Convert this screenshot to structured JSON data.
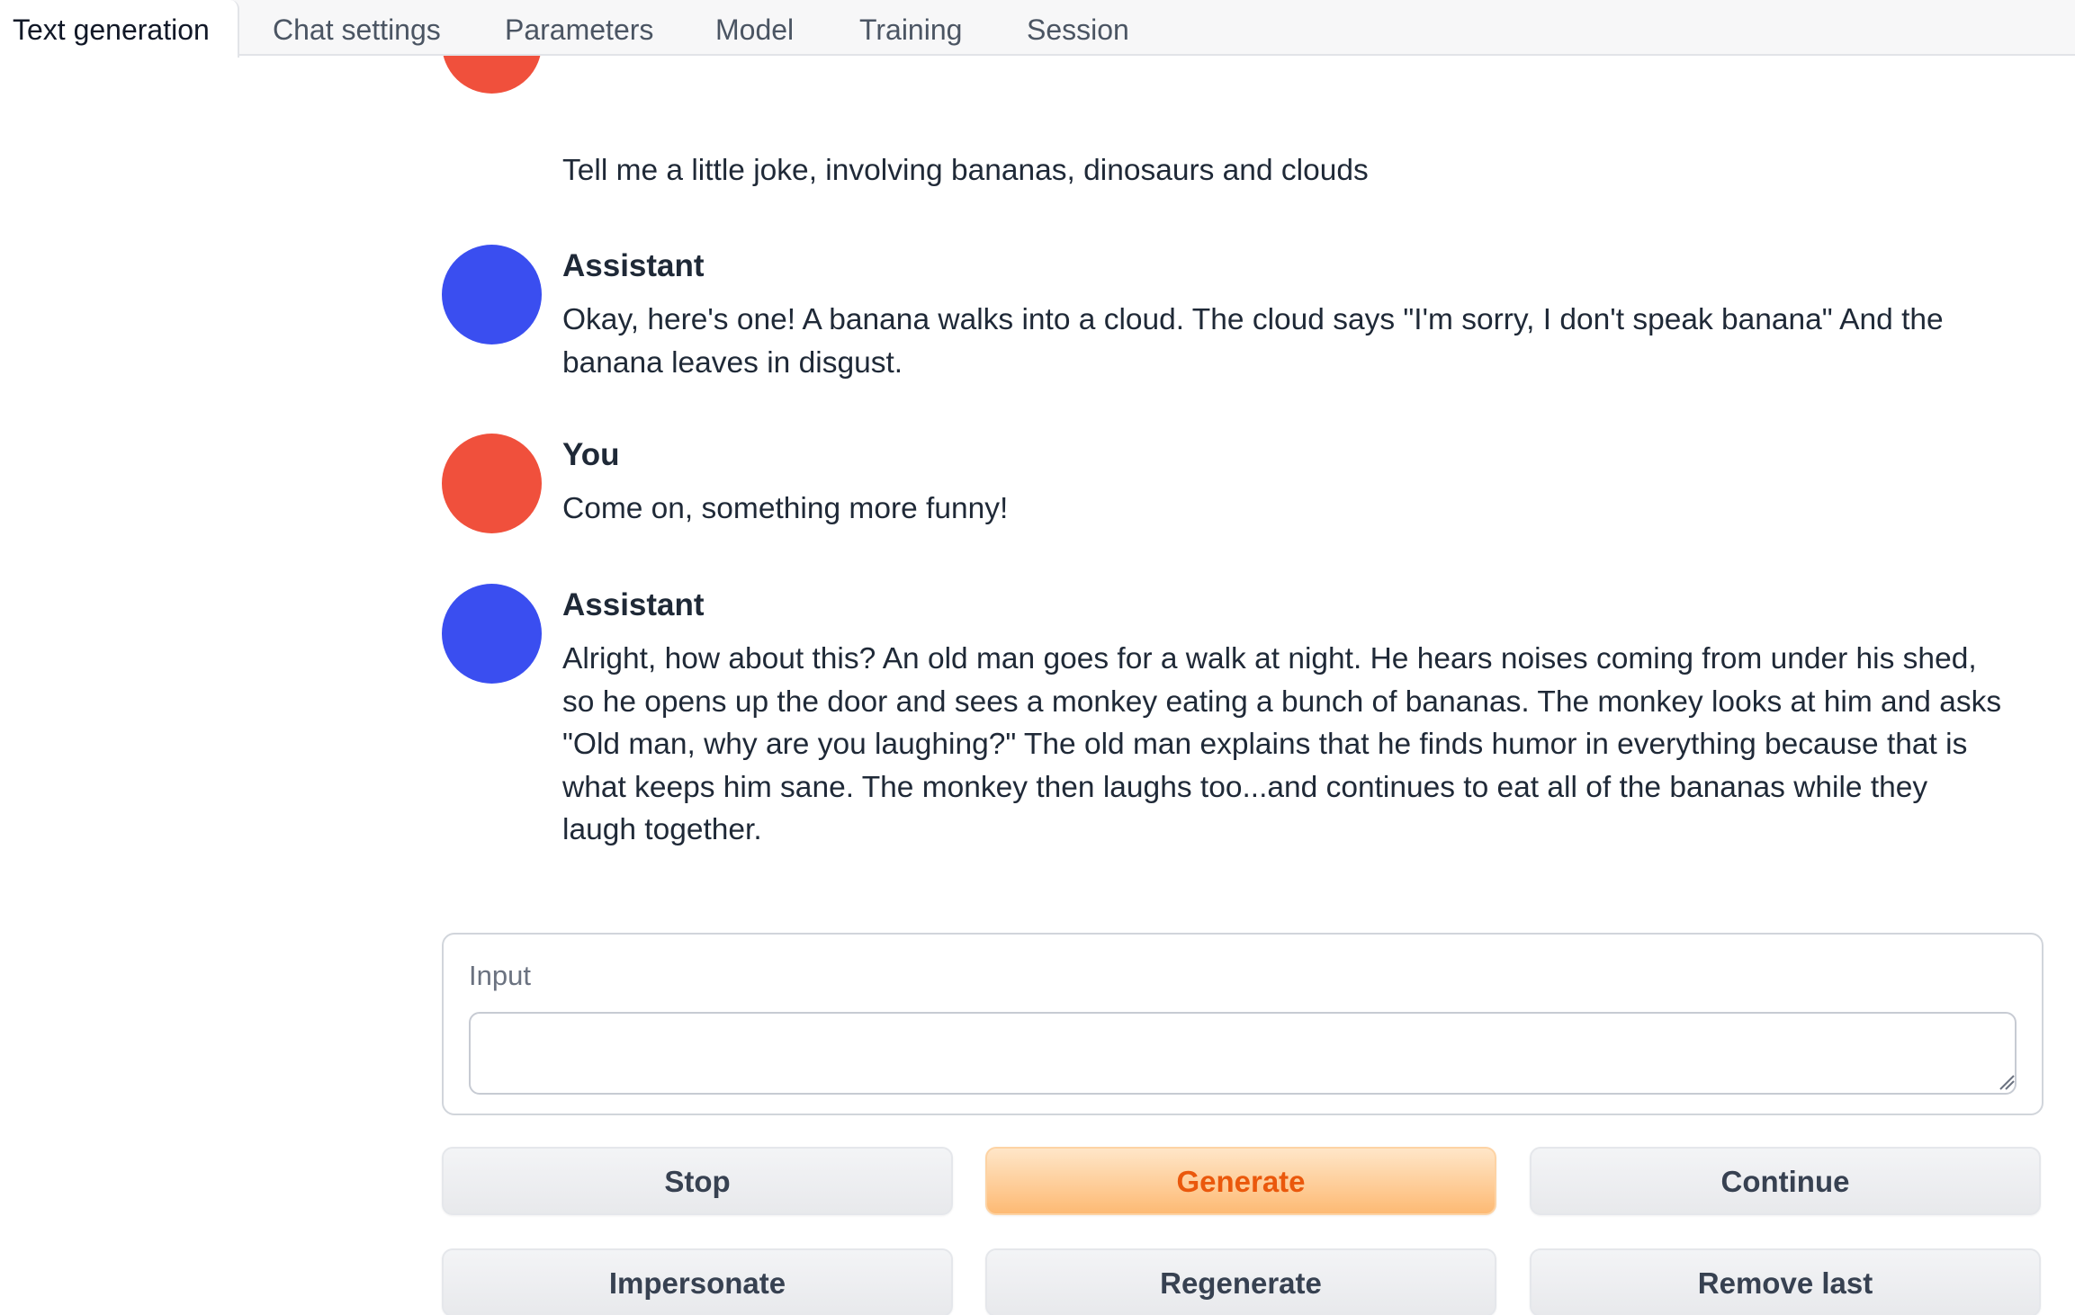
{
  "tabs": [
    {
      "label": "Text generation",
      "active": true
    },
    {
      "label": "Chat settings",
      "active": false
    },
    {
      "label": "Parameters",
      "active": false
    },
    {
      "label": "Model",
      "active": false
    },
    {
      "label": "Training",
      "active": false
    },
    {
      "label": "Session",
      "active": false
    }
  ],
  "chat": {
    "messages": [
      {
        "role": "user",
        "sender": "",
        "text": "Tell me a little joke, involving bananas, dinosaurs and clouds"
      },
      {
        "role": "assistant",
        "sender": "Assistant",
        "text": "Okay, here's one! A banana walks into a cloud. The cloud says \"I'm sorry, I don't speak banana\" And the banana leaves in disgust."
      },
      {
        "role": "user",
        "sender": "You",
        "text": "Come on, something more funny!"
      },
      {
        "role": "assistant",
        "sender": "Assistant",
        "text": "Alright, how about this? An old man goes for a walk at night. He hears noises coming from under his shed, so he opens up the door and sees a monkey eating a bunch of bananas. The monkey looks at him and asks \"Old man, why are you laughing?\" The old man explains that he finds humor in everything because that is what keeps him sane. The monkey then laughs too...and continues to eat all of the bananas while they laugh together."
      }
    ]
  },
  "input": {
    "label": "Input",
    "value": "",
    "placeholder": ""
  },
  "buttons": {
    "stop": "Stop",
    "generate": "Generate",
    "continue": "Continue",
    "impersonate": "Impersonate",
    "regenerate": "Regenerate",
    "remove_last": "Remove last"
  },
  "colors": {
    "user_avatar": "#f0503c",
    "assistant_avatar": "#3a4ef0",
    "primary_text": "#ea580c",
    "primary_bg": "#fdba74"
  }
}
